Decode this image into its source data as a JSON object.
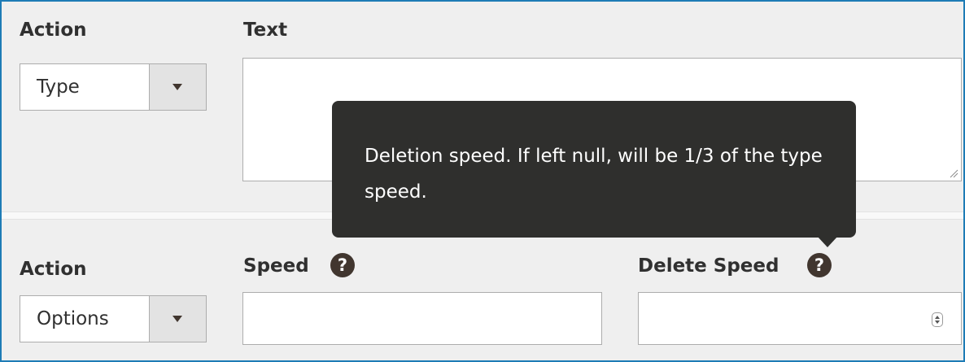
{
  "row1": {
    "action_label": "Action",
    "action_select_value": "Type",
    "text_label": "Text",
    "text_value": ""
  },
  "row2": {
    "action_label": "Action",
    "action_select_value": "Options",
    "speed_label": "Speed",
    "speed_value": "",
    "delete_speed_label": "Delete Speed",
    "delete_speed_value": ""
  },
  "help_icon_glyph": "?",
  "tooltip": {
    "text": "Deletion speed. If left null, will be 1/3 of the type speed."
  },
  "colors": {
    "frame_border": "#1e7cb6",
    "background": "#efefef",
    "tooltip_bg": "#2f2f2d",
    "help_icon": "#41362f"
  },
  "icons": {
    "dropdown": "chevron-down-icon",
    "help": "question-circle-icon",
    "resize": "resize-handle-icon",
    "spinner": "number-spinner-icon"
  }
}
